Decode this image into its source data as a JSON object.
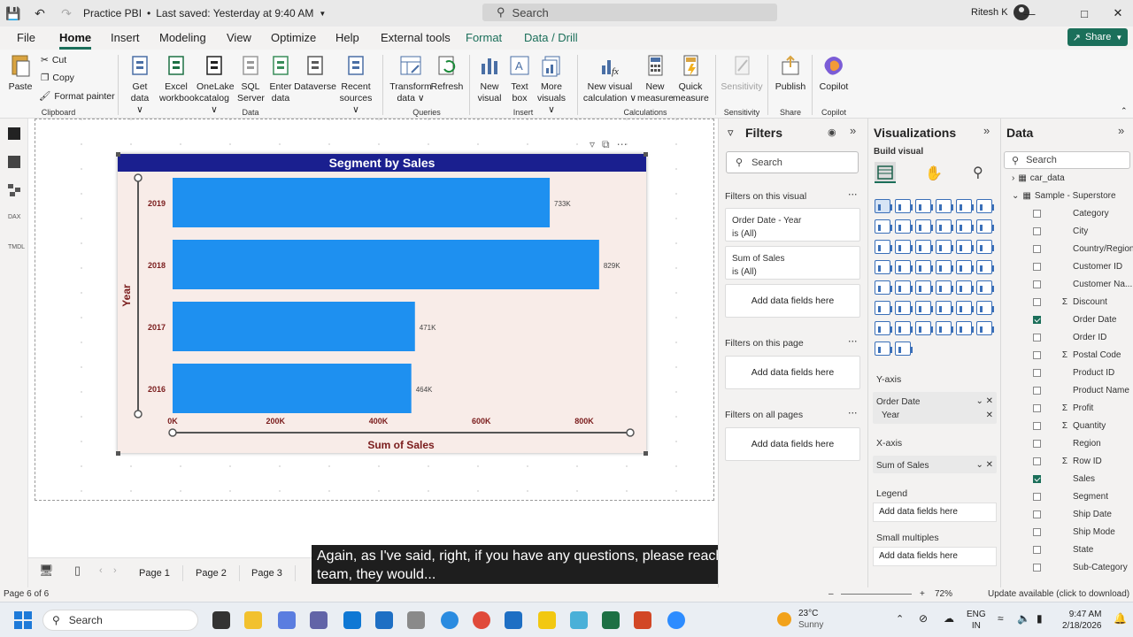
{
  "titlebar": {
    "doc_title": "Practice PBI",
    "saved_status": "Last saved: Yesterday at 9:40 AM",
    "search_placeholder": "Search",
    "user_name": "Ritesh K"
  },
  "menu": {
    "tabs": [
      "File",
      "Home",
      "Insert",
      "Modeling",
      "View",
      "Optimize",
      "Help",
      "External tools",
      "Format",
      "Data / Drill"
    ],
    "active": "Home",
    "share_label": "Share"
  },
  "ribbon": {
    "clipboard": {
      "paste": "Paste",
      "cut": "Cut",
      "copy": "Copy",
      "format_painter": "Format painter",
      "group": "Clipboard"
    },
    "data": {
      "items": [
        {
          "l1": "Get",
          "l2": "data ∨"
        },
        {
          "l1": "Excel",
          "l2": "workbook"
        },
        {
          "l1": "OneLake",
          "l2": "catalog ∨"
        },
        {
          "l1": "SQL",
          "l2": "Server"
        },
        {
          "l1": "Enter",
          "l2": "data"
        },
        {
          "l1": "Dataverse",
          "l2": ""
        },
        {
          "l1": "Recent",
          "l2": "sources ∨"
        }
      ],
      "group": "Data"
    },
    "queries": {
      "transform_l1": "Transform",
      "transform_l2": "data ∨",
      "refresh": "Refresh",
      "group": "Queries"
    },
    "insert": {
      "new_visual_l1": "New",
      "new_visual_l2": "visual",
      "text_box_l1": "Text",
      "text_box_l2": "box",
      "more_l1": "More",
      "more_l2": "visuals ∨",
      "group": "Insert"
    },
    "calculations": {
      "nvc_l1": "New visual",
      "nvc_l2": "calculation ∨",
      "nm_l1": "New",
      "nm_l2": "measure",
      "qm_l1": "Quick",
      "qm_l2": "measure",
      "group": "Calculations"
    },
    "sensitivity": {
      "label": "Sensitivity",
      "group": "Sensitivity"
    },
    "share": {
      "publish": "Publish",
      "group": "Share"
    },
    "copilot": {
      "label": "Copilot",
      "group": "Copilot"
    }
  },
  "visual": {
    "title": "Segment by Sales",
    "header_color": "#1a1f8f",
    "bar_color": "#1e90f0",
    "background_color": "#f8ece8"
  },
  "chart_data": {
    "type": "bar",
    "orientation": "horizontal",
    "title": "Segment by Sales",
    "xlabel": "Sum of Sales",
    "ylabel": "Year",
    "categories": [
      "2019",
      "2018",
      "2017",
      "2016"
    ],
    "values": [
      733000,
      829000,
      471000,
      464000
    ],
    "data_labels": [
      "733K",
      "829K",
      "471K",
      "464K"
    ],
    "xlim": [
      0,
      800000
    ],
    "x_ticks": [
      "0K",
      "200K",
      "400K",
      "600K",
      "800K"
    ],
    "grid": false
  },
  "pages": {
    "tabs": [
      "Page 1",
      "Page 2",
      "Page 3"
    ],
    "status": "Page 6 of 6"
  },
  "caption": "Again, as I've said, right, if you have any questions, please reach out to our team, they would...",
  "status": {
    "zoom": "72%",
    "update": "Update available (click to download)"
  },
  "filters": {
    "title": "Filters",
    "search_placeholder": "Search",
    "on_visual": "Filters on this visual",
    "cards": [
      {
        "name": "Order Date - Year",
        "value": "is (All)"
      },
      {
        "name": "Sum of Sales",
        "value": "is (All)"
      }
    ],
    "add_here": "Add data fields here",
    "on_page": "Filters on this page",
    "on_all": "Filters on all pages"
  },
  "visualizations": {
    "title": "Visualizations",
    "build": "Build visual",
    "y_axis_label": "Y-axis",
    "y_field_1": "Order Date",
    "y_field_2": "Year",
    "x_axis_label": "X-axis",
    "x_field": "Sum of Sales",
    "legend_label": "Legend",
    "small_multiples_label": "Small multiples",
    "add_here": "Add data fields here"
  },
  "data_pane": {
    "title": "Data",
    "search_placeholder": "Search",
    "tables": [
      "car_data",
      "Sample - Superstore"
    ],
    "fields": [
      {
        "name": "Category",
        "checked": false,
        "sigma": false
      },
      {
        "name": "City",
        "checked": false,
        "sigma": false
      },
      {
        "name": "Country/Region",
        "checked": false,
        "sigma": false
      },
      {
        "name": "Customer ID",
        "checked": false,
        "sigma": false
      },
      {
        "name": "Customer Na...",
        "checked": false,
        "sigma": false
      },
      {
        "name": "Discount",
        "checked": false,
        "sigma": true
      },
      {
        "name": "Order Date",
        "checked": true,
        "sigma": false
      },
      {
        "name": "Order ID",
        "checked": false,
        "sigma": false
      },
      {
        "name": "Postal Code",
        "checked": false,
        "sigma": true
      },
      {
        "name": "Product ID",
        "checked": false,
        "sigma": false
      },
      {
        "name": "Product Name",
        "checked": false,
        "sigma": false
      },
      {
        "name": "Profit",
        "checked": false,
        "sigma": true
      },
      {
        "name": "Quantity",
        "checked": false,
        "sigma": true
      },
      {
        "name": "Region",
        "checked": false,
        "sigma": false
      },
      {
        "name": "Row ID",
        "checked": false,
        "sigma": true
      },
      {
        "name": "Sales",
        "checked": true,
        "sigma": false
      },
      {
        "name": "Segment",
        "checked": false,
        "sigma": false
      },
      {
        "name": "Ship Date",
        "checked": false,
        "sigma": false
      },
      {
        "name": "Ship Mode",
        "checked": false,
        "sigma": false
      },
      {
        "name": "State",
        "checked": false,
        "sigma": false
      },
      {
        "name": "Sub-Category",
        "checked": false,
        "sigma": false
      }
    ]
  },
  "taskbar": {
    "search_placeholder": "Search",
    "temperature": "23°C",
    "weather": "Sunny",
    "lang1": "ENG",
    "lang2": "IN",
    "time": "9:47 AM",
    "date": "2/18/2026"
  }
}
